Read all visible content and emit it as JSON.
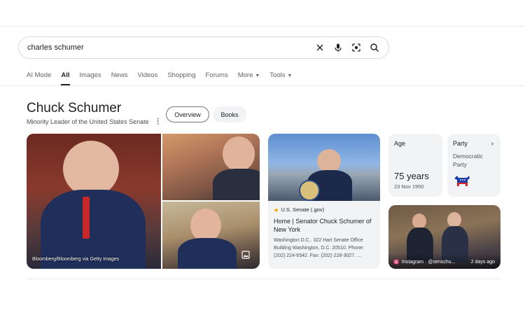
{
  "search": {
    "query": "charles schumer",
    "icons": [
      "close-icon",
      "microphone-icon",
      "lens-icon",
      "search-icon"
    ]
  },
  "tabs": [
    {
      "label": "AI Mode"
    },
    {
      "label": "All",
      "active": true
    },
    {
      "label": "Images"
    },
    {
      "label": "News"
    },
    {
      "label": "Videos"
    },
    {
      "label": "Shopping"
    },
    {
      "label": "Forums"
    },
    {
      "label": "More",
      "dropdown": true
    },
    {
      "label": "Tools",
      "dropdown": true
    }
  ],
  "entity": {
    "title": "Chuck Schumer",
    "subtitle": "Minority Leader of the United States Senate",
    "chips": [
      {
        "label": "Overview",
        "selected": true
      },
      {
        "label": "Books"
      }
    ]
  },
  "photos": {
    "credit": "Bloomberg/Bloomberg via Getty Images"
  },
  "result": {
    "source": "U.S. Senate (.gov)",
    "title": "Home | Senator Chuck Schumer of New York",
    "snippet": "Washington D.C.. 322 Hart Senate Office Building Washington, D.C. 20510. Phone: (202) 224-6542. Fax: (202) 228-3027. ..."
  },
  "facts": {
    "age": {
      "label": "Age",
      "value": "75 years",
      "date": "23 Nov 1950"
    },
    "party": {
      "label": "Party",
      "value": "Democratic Party"
    }
  },
  "instagram": {
    "source": "Instagram · @senschu...",
    "time": "2 days ago"
  },
  "colors": {
    "accent": "#202124",
    "card_bg": "#f1f3f4",
    "party_blue": "#1f3ea8",
    "party_red": "#d6282b"
  }
}
